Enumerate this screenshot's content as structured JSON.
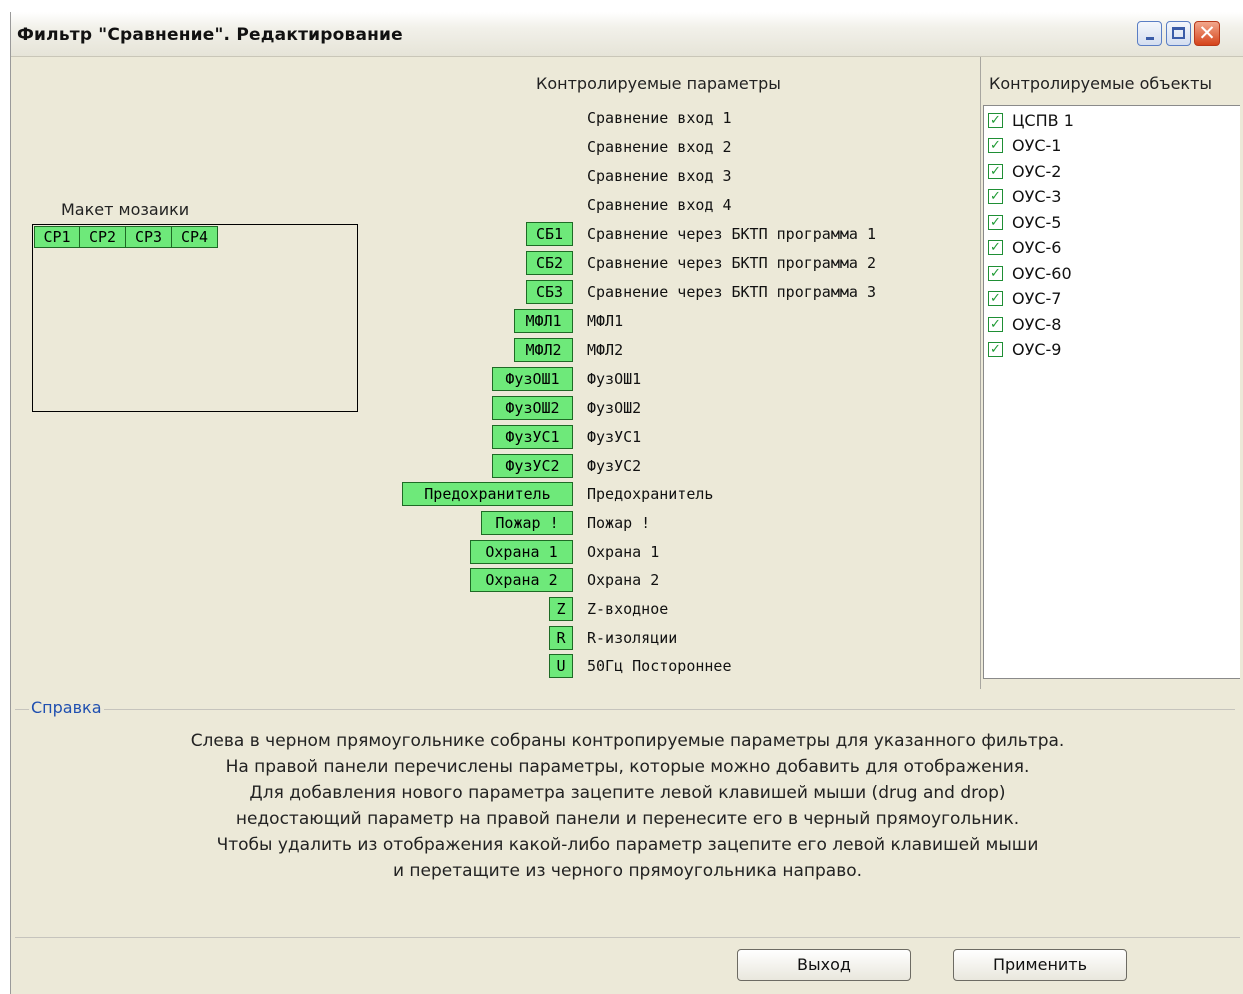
{
  "window": {
    "title": "Фильтр \"Сравнение\".  Редактирование",
    "minimize": "minimize-icon",
    "maximize": "maximize-icon",
    "close": "✕"
  },
  "mosaic": {
    "label": "Макет мозаики",
    "cells": [
      "СР1",
      "СР2",
      "СР3",
      "СР4"
    ],
    "cell_color": "#6ee97a"
  },
  "params": {
    "title": "Контролируемые параметры",
    "items": [
      {
        "tag": "",
        "label": "Сравнение вход 1"
      },
      {
        "tag": "",
        "label": "Сравнение вход 2"
      },
      {
        "tag": "",
        "label": "Сравнение вход 3"
      },
      {
        "tag": "",
        "label": "Сравнение вход 4"
      },
      {
        "tag": "СБ1",
        "label": "Сравнение через БКТП программа 1"
      },
      {
        "tag": "СБ2",
        "label": "Сравнение через БКТП программа 2"
      },
      {
        "tag": "СБ3",
        "label": "Сравнение через БКТП программа 3"
      },
      {
        "tag": "МФЛ1",
        "label": "МФЛ1"
      },
      {
        "tag": "МФЛ2",
        "label": "МФЛ2"
      },
      {
        "tag": "ФузОШ1",
        "label": "ФузОШ1"
      },
      {
        "tag": "ФузОШ2",
        "label": "ФузОШ2"
      },
      {
        "tag": "ФузУС1",
        "label": "ФузУС1"
      },
      {
        "tag": "ФузУС2",
        "label": "ФузУС2"
      },
      {
        "tag": "Предохранитель",
        "label": "Предохранитель"
      },
      {
        "tag": "Пожар !",
        "label": "Пожар !"
      },
      {
        "tag": "Охрана 1",
        "label": "Охрана 1"
      },
      {
        "tag": "Охрана 2",
        "label": "Охрана 2"
      },
      {
        "tag": "Z",
        "label": "Z-входное"
      },
      {
        "tag": "R",
        "label": "R-изоляции"
      },
      {
        "tag": "U",
        "label": "50Гц Постороннее"
      }
    ]
  },
  "objects": {
    "title": "Контролируемые объекты",
    "items": [
      {
        "label": "ЦСПВ 1",
        "checked": true
      },
      {
        "label": "ОУС-1",
        "checked": true
      },
      {
        "label": "ОУС-2",
        "checked": true
      },
      {
        "label": "ОУС-3",
        "checked": true
      },
      {
        "label": "ОУС-5",
        "checked": true
      },
      {
        "label": "ОУС-6",
        "checked": true
      },
      {
        "label": "ОУС-60",
        "checked": true
      },
      {
        "label": "ОУС-7",
        "checked": true
      },
      {
        "label": "ОУС-8",
        "checked": true
      },
      {
        "label": "ОУС-9",
        "checked": true
      }
    ]
  },
  "help": {
    "title": "Справка",
    "lines": [
      "Слева в черном прямоугольнике собраны контропируемые параметры для указанного фильтра.",
      "На правой панели перечислены параметры, которые можно добавить для отображения.",
      "Для добавления нового параметра зацепите левой клавишей мыши (drug and drop)",
      "недостающий параметр на правой панели и перенесите его в черный прямоугольник.",
      "Чтобы удалить из отображения какой-либо параметр зацепите его левой клавишей мыши",
      "и перетащите из черного прямоугольника направо."
    ]
  },
  "buttons": {
    "exit": "Выход",
    "apply": "Применить"
  }
}
